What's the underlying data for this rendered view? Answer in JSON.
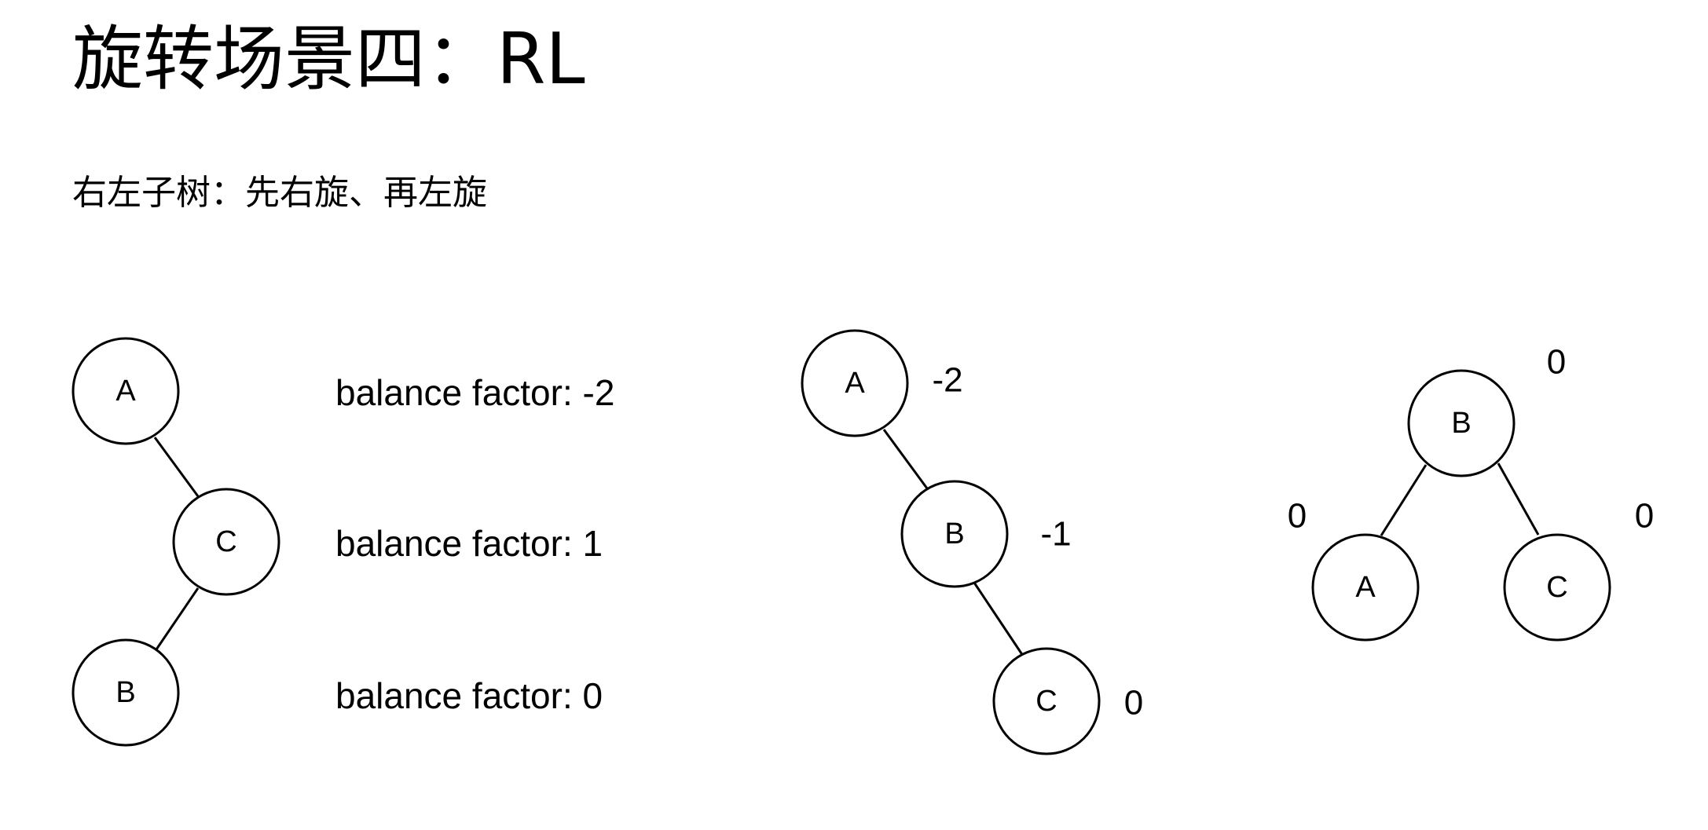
{
  "title": "旋转场景四：RL",
  "subtitle": "右左子树：先右旋、再左旋",
  "trees": [
    {
      "nodes": [
        {
          "label": "A",
          "factor": ""
        },
        {
          "label": "C",
          "factor": ""
        },
        {
          "label": "B",
          "factor": ""
        }
      ],
      "factor_texts": [
        "balance factor: -2",
        "balance factor: 1",
        "balance factor: 0"
      ]
    },
    {
      "nodes": [
        {
          "label": "A",
          "factor": "-2"
        },
        {
          "label": "B",
          "factor": "-1"
        },
        {
          "label": "C",
          "factor": "0"
        }
      ]
    },
    {
      "nodes": [
        {
          "label": "B",
          "factor": "0"
        },
        {
          "label": "A",
          "factor": "0"
        },
        {
          "label": "C",
          "factor": "0"
        }
      ]
    }
  ]
}
